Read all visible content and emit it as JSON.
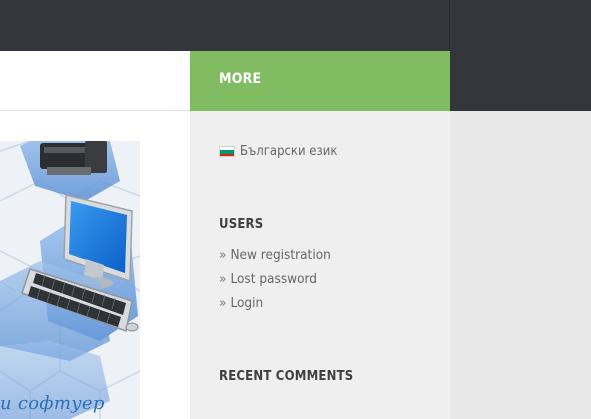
{
  "sidebar": {
    "tab_label": "MORE",
    "language": {
      "label": "Български език",
      "flag_icon": "bulgarian-flag-icon"
    },
    "users_title": "USERS",
    "user_links": [
      {
        "arrow": "»",
        "label": "New registration"
      },
      {
        "arrow": "»",
        "label": "Lost password"
      },
      {
        "arrow": "»",
        "label": "Login"
      }
    ],
    "recent_comments_title": "RECENT COMMENTS"
  },
  "content": {
    "image_caption": "и софтуер"
  },
  "colors": {
    "topbar": "#33363b",
    "accent_green": "#82bc62",
    "sidebar_bg": "#efefef",
    "caption_blue": "#2e6fb7"
  }
}
